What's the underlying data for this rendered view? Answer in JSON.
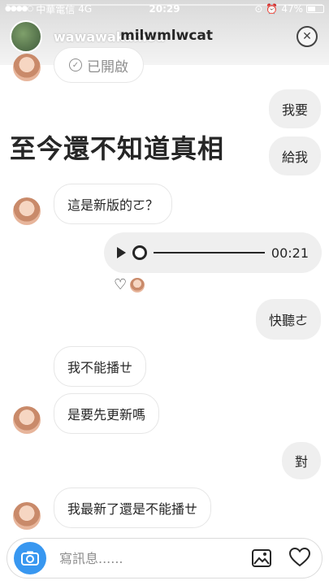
{
  "status": {
    "carrier": "中華電信",
    "network": "4G",
    "time": "20:29",
    "battery": "47%"
  },
  "story": {
    "username": "wawawakamou",
    "thread_title": "milwmlwcat"
  },
  "chat": {
    "opened_label": "已開啟",
    "caption": "至今還不知道真相",
    "messages": [
      {
        "side": "out",
        "text": "我要"
      },
      {
        "side": "out",
        "text": "給我"
      },
      {
        "side": "in",
        "text": "這是新版的ㄛ？"
      },
      {
        "side": "out",
        "text": "快聽ㄜ"
      },
      {
        "side": "in",
        "text": "我不能播ㄝ"
      },
      {
        "side": "in",
        "text": "是要先更新嗎"
      },
      {
        "side": "out",
        "text": "對"
      },
      {
        "side": "in",
        "text": "我最新了還是不能播ㄝ"
      }
    ],
    "voice_duration": "00:21"
  },
  "composer": {
    "placeholder": "寫訊息......"
  },
  "colors": {
    "accent": "#3897f0",
    "bubble_out": "#efefef",
    "bubble_in_border": "#e6e6e6"
  }
}
